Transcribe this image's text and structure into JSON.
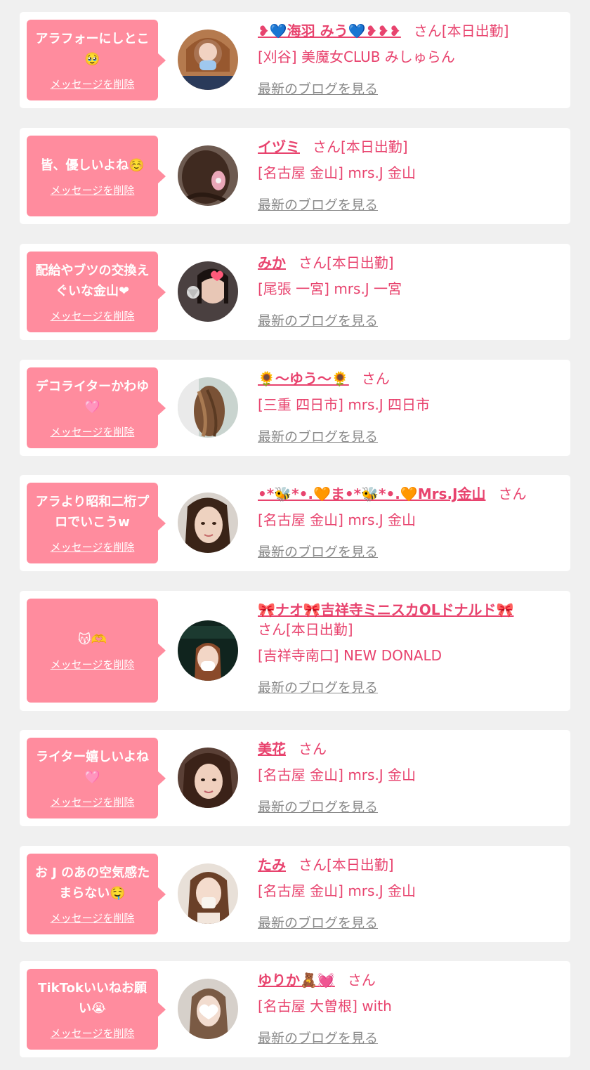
{
  "common": {
    "delete_label": "メッセージを削除",
    "blog_label": "最新のブログを見る",
    "san_label": "さん"
  },
  "colors": {
    "accent_pink": "#e8436e",
    "bubble_pink": "#ff8c9e",
    "card_bg": "#ffffff",
    "page_bg": "#f0f0f0",
    "link_gray": "#8a8a8a"
  },
  "items": [
    {
      "message": "アラフォーにしとこ🥹",
      "name": "❥💙海羽 みう💙❥❥❥",
      "status": "[本日出勤]",
      "shop": "[刈谷] 美魔女CLUB みしゅらん"
    },
    {
      "message": "皆、優しいよね☺️",
      "name": "イヅミ",
      "status": "[本日出勤]",
      "shop": "[名古屋 金山] mrs.J 金山"
    },
    {
      "message": "配給やブツの交換えぐいな金山❤",
      "name": "みか",
      "status": "[本日出勤]",
      "shop": "[尾張 一宮] mrs.J 一宮"
    },
    {
      "message": "デコライターかわゆ🩷",
      "name": "🌻〜ゆう〜🌻",
      "status": "",
      "shop": "[三重 四日市] mrs.J 四日市"
    },
    {
      "message": "アラより昭和二桁プロでいこうw",
      "name": "•*🐝*•.🧡ま•*🐝*•.🧡Mrs.J金山",
      "status": "",
      "shop": "[名古屋 金山] mrs.J 金山"
    },
    {
      "message": "😽🫶",
      "name": "🎀ナオ🎀吉祥寺ミニスカOLドナルド🎀",
      "status": "[本日出勤]",
      "shop": "[吉祥寺南口] NEW DONALD"
    },
    {
      "message": "ライター嬉しいよね🩷",
      "name": "美花",
      "status": "",
      "shop": "[名古屋 金山] mrs.J 金山"
    },
    {
      "message": "お J のあの空気感たまらない🤤",
      "name": "たみ",
      "status": "[本日出勤]",
      "shop": "[名古屋 金山] mrs.J 金山"
    },
    {
      "message": "TikTokいいねお願い😭",
      "name": "ゆりか🧸💓",
      "status": "",
      "shop": "[名古屋 大曽根] with"
    }
  ]
}
